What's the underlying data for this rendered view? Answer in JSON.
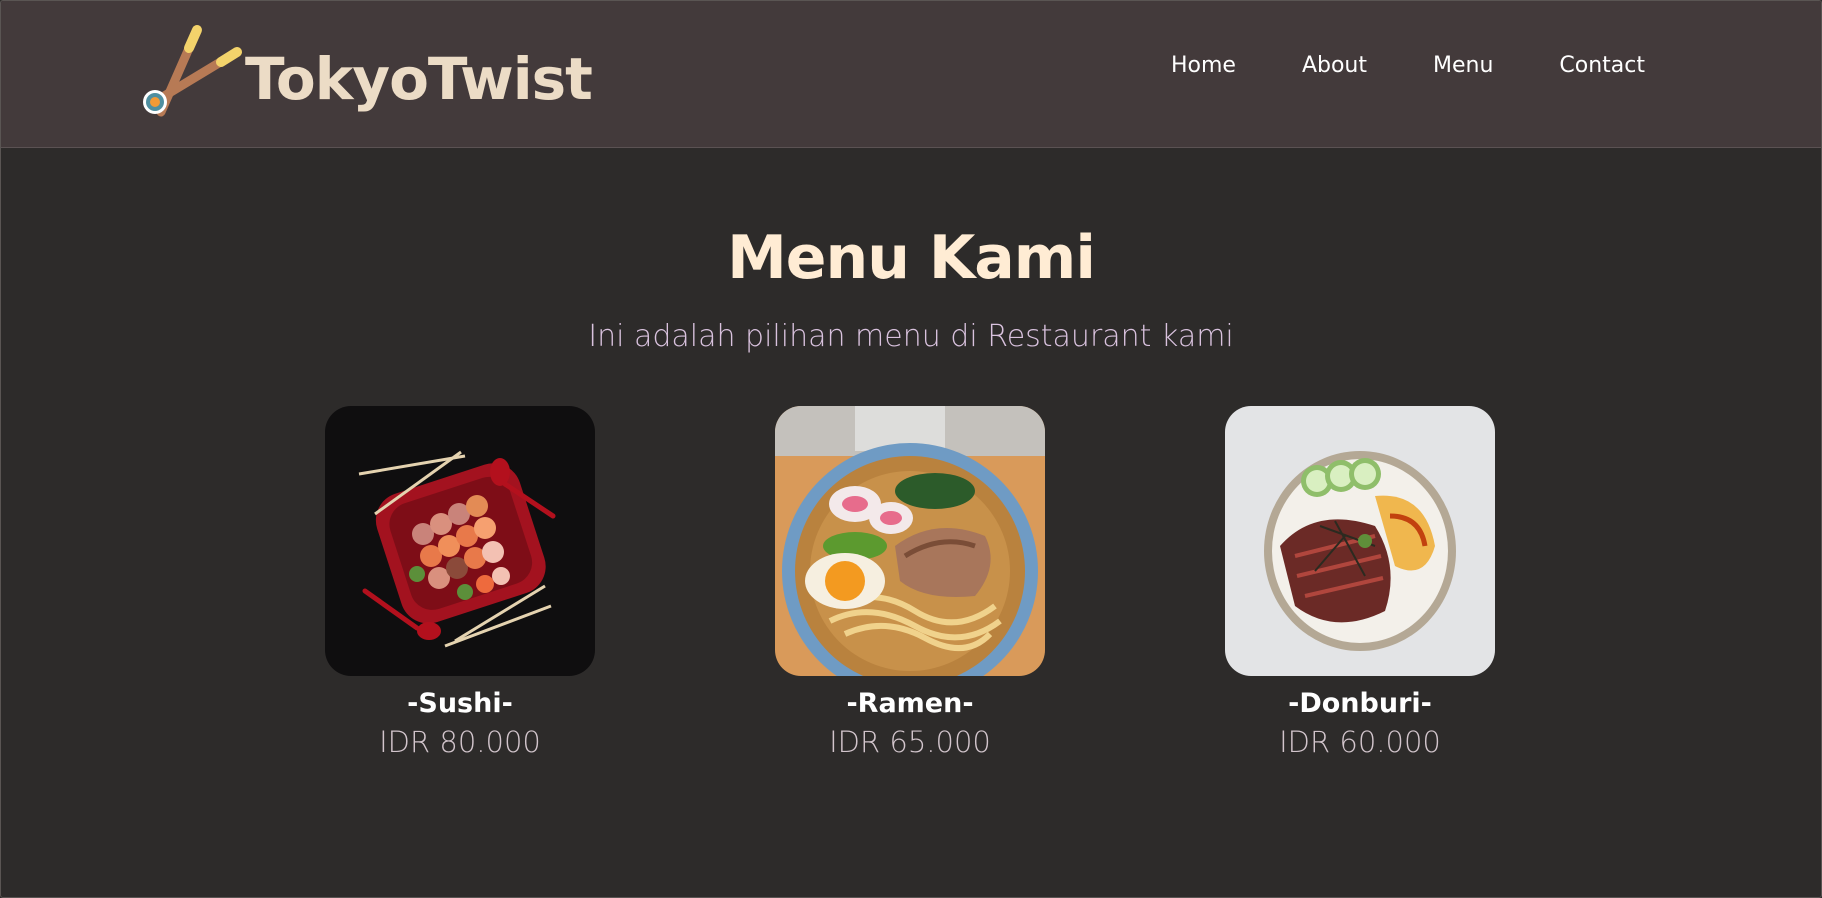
{
  "header": {
    "brand": "TokyoTwist",
    "logo_icon": "chopsticks-sushi-icon",
    "nav": [
      {
        "label": "Home"
      },
      {
        "label": "About"
      },
      {
        "label": "Menu"
      },
      {
        "label": "Contact"
      }
    ]
  },
  "menu": {
    "title": "Menu Kami",
    "subtitle": "Ini adalah pilihan menu di Restaurant kami",
    "items": [
      {
        "name": "-Sushi-",
        "price": "IDR 80.000",
        "image": "sushi-platter-image"
      },
      {
        "name": "-Ramen-",
        "price": "IDR 65.000",
        "image": "ramen-bowl-image"
      },
      {
        "name": "-Donburi-",
        "price": "IDR 60.000",
        "image": "donburi-bowl-image"
      }
    ]
  },
  "colors": {
    "header_bg": "#433a3b",
    "page_bg": "#2d2b2a",
    "brand": "#ecdcc6",
    "title": "#ffecd4",
    "subtitle": "#d9c2de"
  }
}
